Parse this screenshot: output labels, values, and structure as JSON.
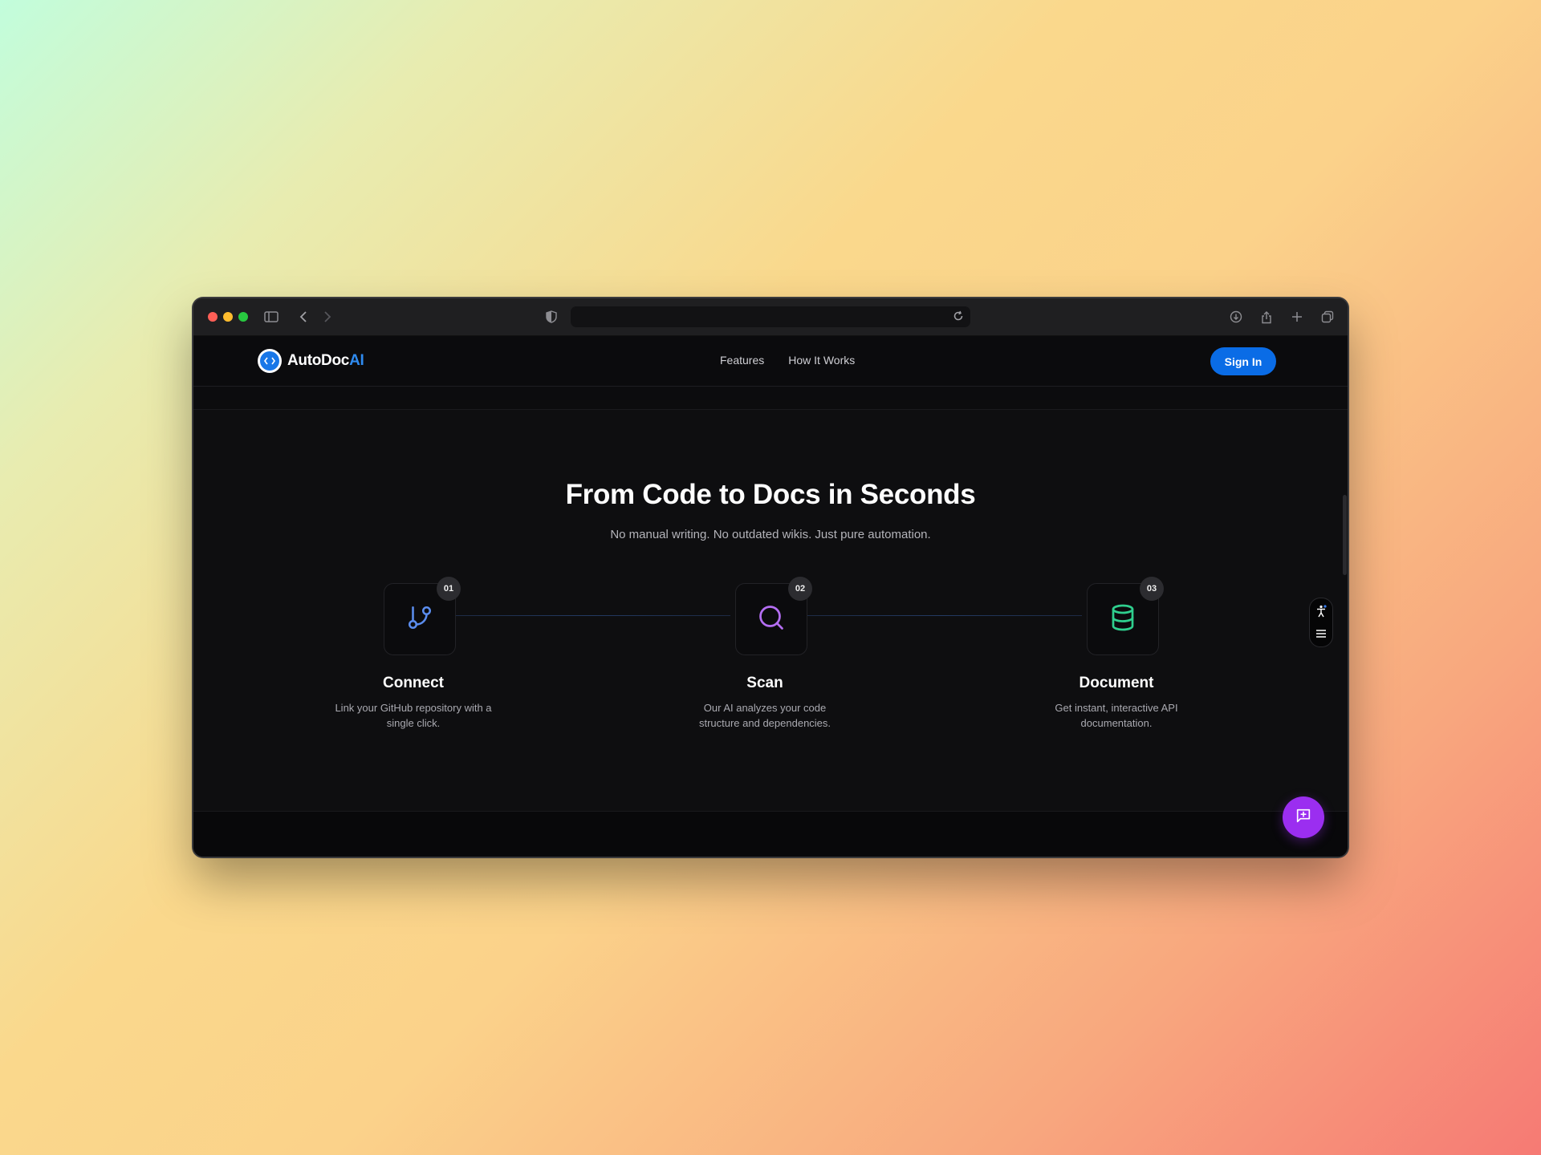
{
  "brand": {
    "name_primary": "AutoDoc",
    "name_accent": "AI"
  },
  "nav": {
    "links": [
      "Features",
      "How It Works"
    ],
    "signin_label": "Sign In"
  },
  "browser": {
    "url": ""
  },
  "section": {
    "title": "From Code to Docs in Seconds",
    "subtitle": "No manual writing. No outdated wikis. Just pure automation."
  },
  "steps": [
    {
      "number": "01",
      "title": "Connect",
      "desc": "Link your GitHub repository with a single click.",
      "icon": "git-branch-icon",
      "color": "#5b8dee"
    },
    {
      "number": "02",
      "title": "Scan",
      "desc": "Our AI analyzes your code structure and dependencies.",
      "icon": "search-icon",
      "color": "#b46ef2"
    },
    {
      "number": "03",
      "title": "Document",
      "desc": "Get instant, interactive API documentation.",
      "icon": "database-icon",
      "color": "#2fcf8e"
    }
  ],
  "colors": {
    "accent": "#0a6ce6",
    "chat": "#9b2ef0"
  }
}
